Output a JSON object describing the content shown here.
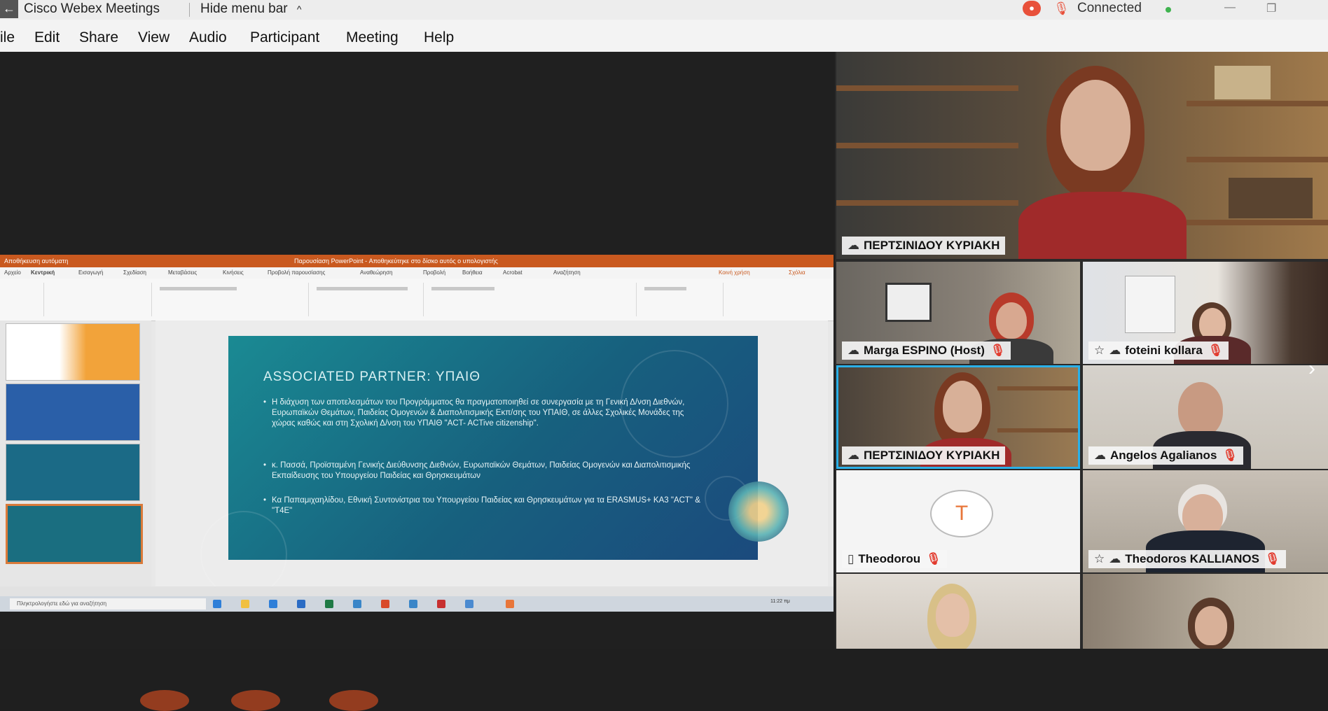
{
  "titlebar": {
    "back_glyph": "←",
    "app_title": "Cisco Webex Meetings",
    "hide_menu": "Hide menu bar",
    "hide_menu_chevron": "^",
    "recording_glyph": "⏺",
    "mute_glyph": "🎙",
    "status": "Connected",
    "status_color": "#3fb34f",
    "minimize_glyph": "—",
    "restore_glyph": "❐"
  },
  "menu": {
    "items": [
      "ile",
      "Edit",
      "Share",
      "View",
      "Audio",
      "Participant",
      "Meeting",
      "Help"
    ]
  },
  "shared_content": {
    "window_title_left": "Αποθήκευση αυτόματη",
    "window_title": "Παρουσίαση PowerPoint - Αποθηκεύτηκε στο δίσκο αυτός ο υπολογιστής",
    "ribbon_tabs": [
      "Αρχείο",
      "Κεντρική",
      "Εισαγωγή",
      "Σχεδίαση",
      "Μεταβάσεις",
      "Κινήσεις",
      "Προβολή παρουσίασης",
      "Αναθεώρηση",
      "Προβολή",
      "Βοήθεια",
      "Acrobat",
      "Αναζήτηση",
      "Κοινή χρήση",
      "Σχόλια"
    ],
    "slide": {
      "heading": "ASSOCIATED PARTNER: ΥΠΑΙΘ",
      "bullet_1": "Η διάχυση των αποτελεσμάτων του Προγράμματος θα πραγματοποιηθεί σε συνεργασία με τη Γενική Δ/νση Διεθνών, Ευρωπαϊκών Θεμάτων, Παιδείας Ομογενών & Διαπολιτισμικής Εκπ/σης του ΥΠΑΙΘ, σε άλλες Σχολικές Μονάδες της χώρας καθώς και στη Σχολική Δ/νση του ΥΠΑΙΘ \"ACT- ACTive citizenship\".",
      "bullet_2": "κ. Πασσά, Προϊσταμένη Γενικής Διεύθυνσης Διεθνών, Ευρωπαϊκών Θεμάτων, Παιδείας Ομογενών και Διαπολιτισμικής Εκπαίδευσης του Υπουργείου Παιδείας και Θρησκευμάτων",
      "bullet_3": "Κα Παπαμιχαηλίδου, Εθνική Συντονίστρια του Υπουργείου Παιδείας και Θρησκευμάτων για τα ERASMUS+ KA3 \"ACT\" & \"T4E\""
    },
    "taskbar_search": "Πληκτρολογήστε εδώ για αναζήτηση",
    "clock": "11:22 πμ"
  },
  "participants": [
    {
      "name": "ΠΕΡΤΣΙΝΙΔΟΥ ΚΥΡΙΑΚΗ",
      "muted": false,
      "active_speaker": true
    },
    {
      "name": "Marga ESPINO (Host)",
      "muted": true
    },
    {
      "name": "foteini kollara",
      "muted": true
    },
    {
      "name": "ΠΕΡΤΣΙΝΙΔΟΥ ΚΥΡΙΑΚΗ",
      "muted": false
    },
    {
      "name": "Angelos Agalianos",
      "muted": true
    },
    {
      "name": "Theodorou",
      "muted": true,
      "avatar_letter": "T"
    },
    {
      "name": "Theodoros KALLIANOS",
      "muted": true
    }
  ],
  "icons": {
    "mute": "🎙",
    "connection": "☁",
    "next_page": "›"
  },
  "colors": {
    "accent_orange": "#e8503a",
    "active_blue": "#2ab0e8",
    "ppt_orange": "#c9591f"
  }
}
